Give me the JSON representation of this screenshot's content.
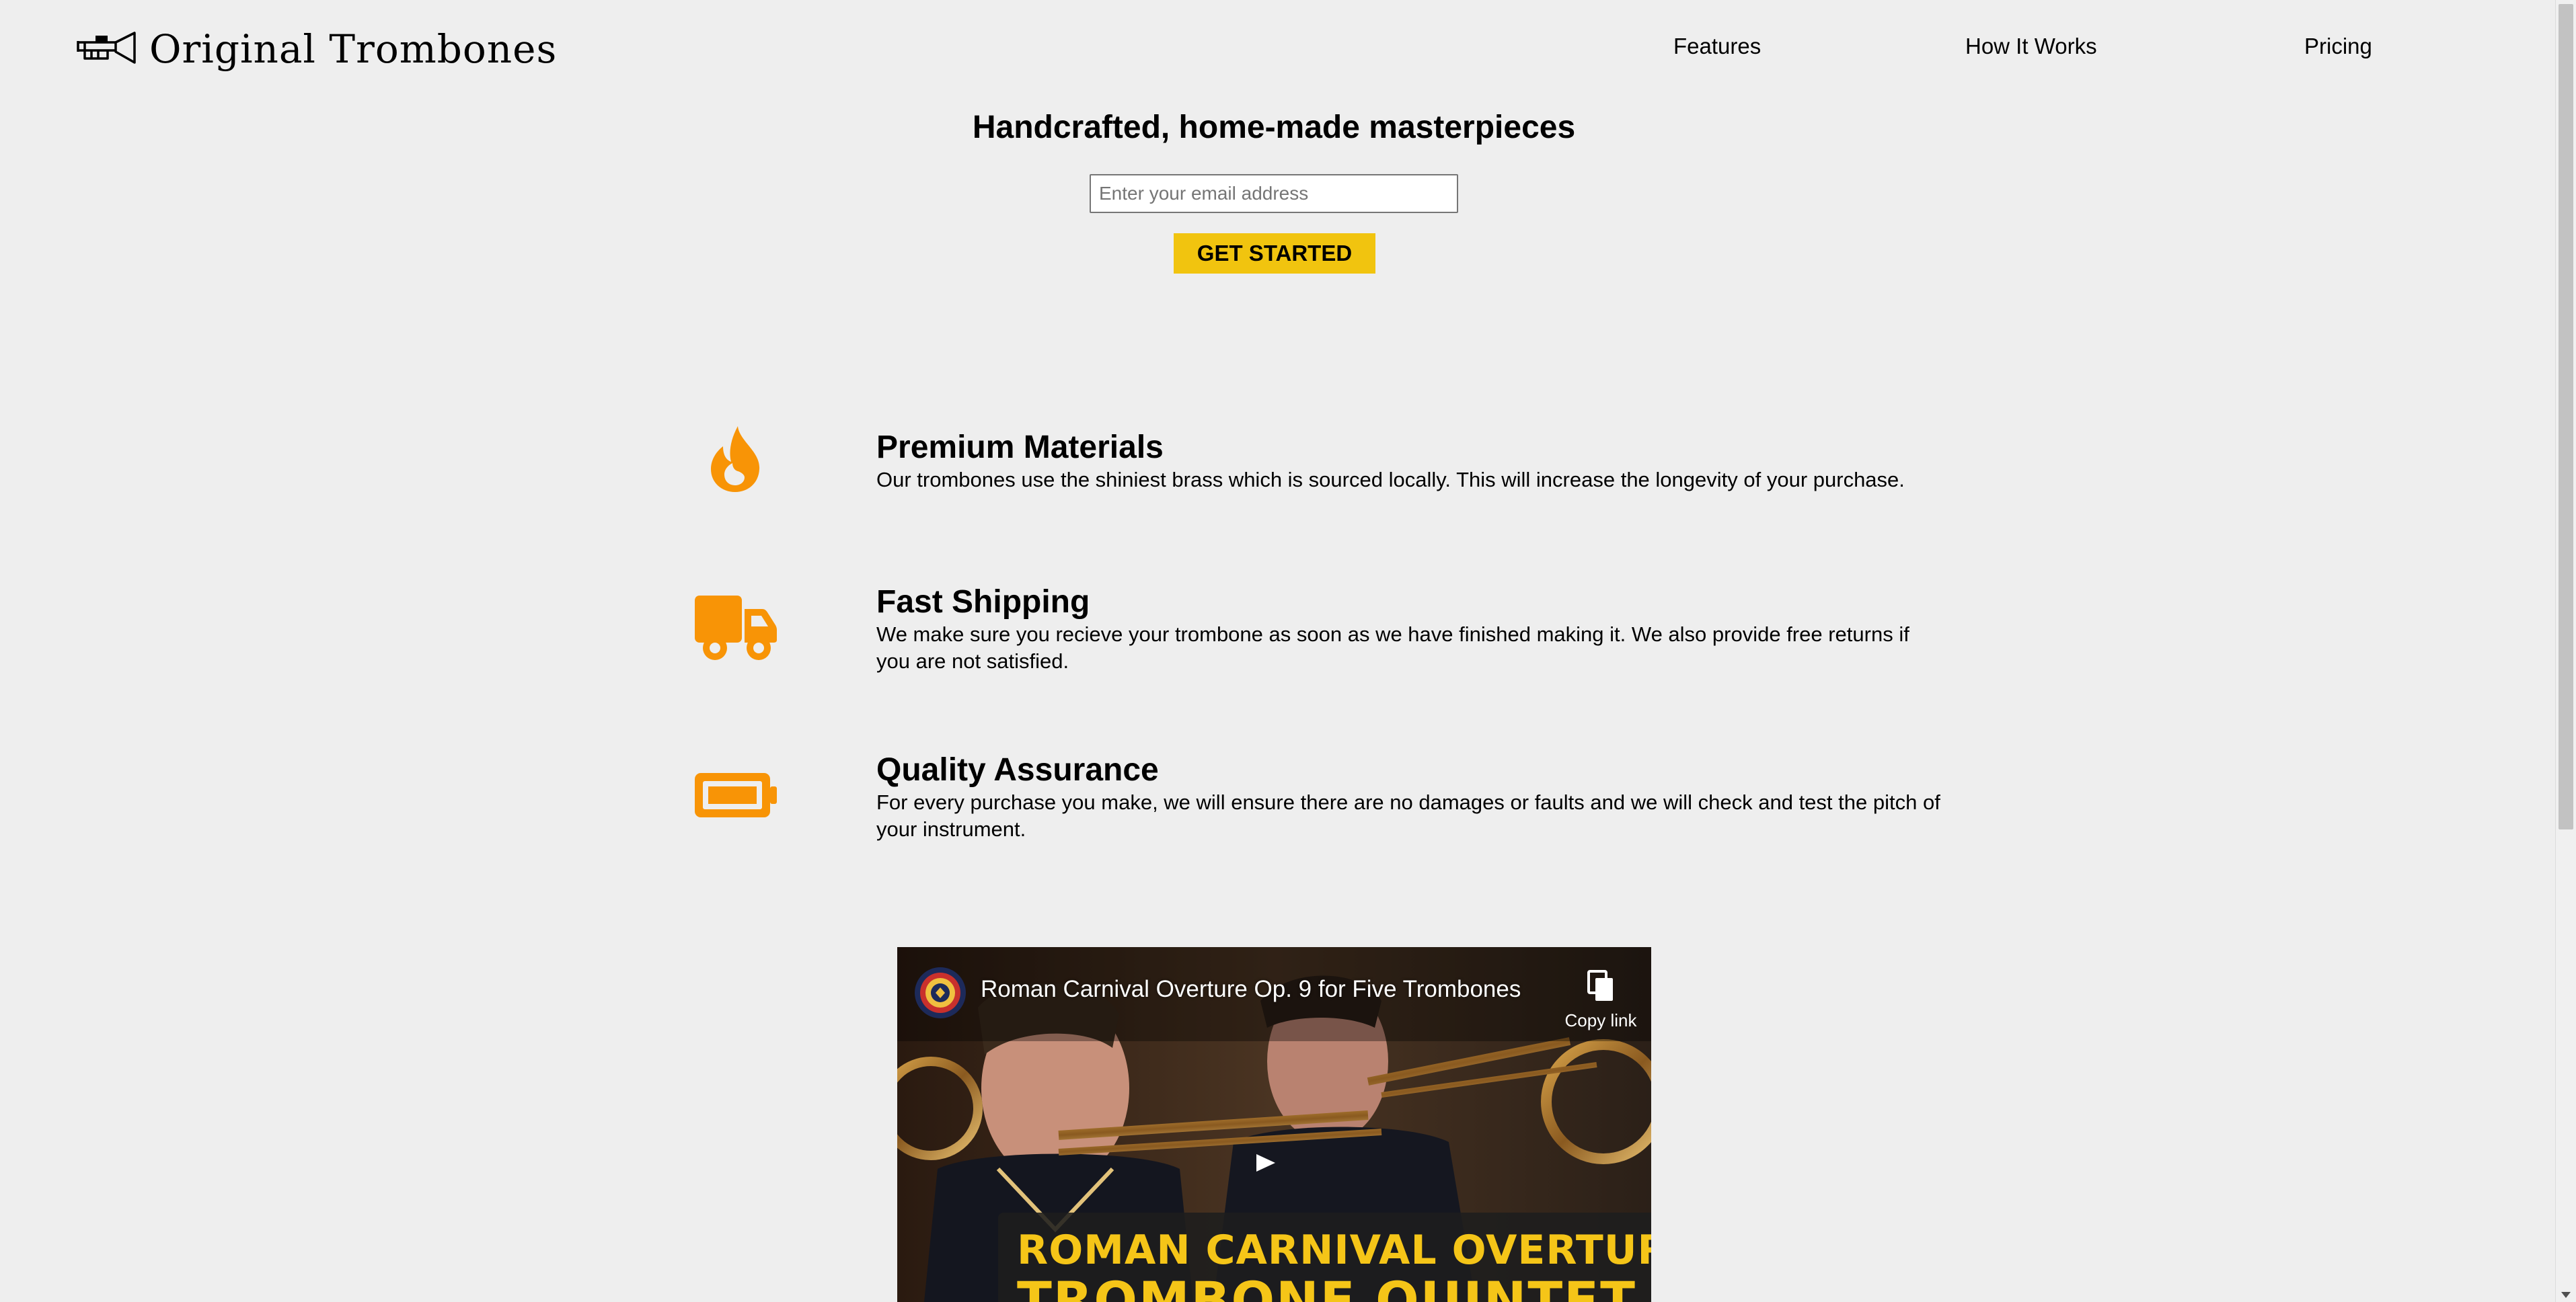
{
  "header": {
    "logo_text": "Original Trombones",
    "nav": [
      {
        "label": "Features"
      },
      {
        "label": "How It Works"
      },
      {
        "label": "Pricing"
      }
    ]
  },
  "hero": {
    "title": "Handcrafted, home-made masterpieces",
    "email_placeholder": "Enter your email address",
    "email_value": "",
    "cta_label": "GET STARTED"
  },
  "features": [
    {
      "icon": "fire-icon",
      "title": "Premium Materials",
      "text": "Our trombones use the shiniest brass which is sourced locally. This will increase the longevity of your purchase."
    },
    {
      "icon": "truck-icon",
      "title": "Fast Shipping",
      "text": "We make sure you recieve your trombone as soon as we have finished making it. We also provide free returns if you are not satisfied."
    },
    {
      "icon": "battery-icon",
      "title": "Quality Assurance",
      "text": "For every purchase you make, we will ensure there are no damages or faults and we will check and test the pitch of your instrument."
    }
  ],
  "video": {
    "title": "Roman Carnival Overture Op. 9 for Five Trombones",
    "copy_link_label": "Copy link",
    "banner_line1": "ROMAN CARNIVAL OVERTURE",
    "banner_line2": "TROMBONE QUINTET"
  },
  "colors": {
    "accent_orange": "#f89406",
    "cta_yellow": "#f1c40f",
    "background": "#eeeeee",
    "banner_text": "#f5c518"
  }
}
